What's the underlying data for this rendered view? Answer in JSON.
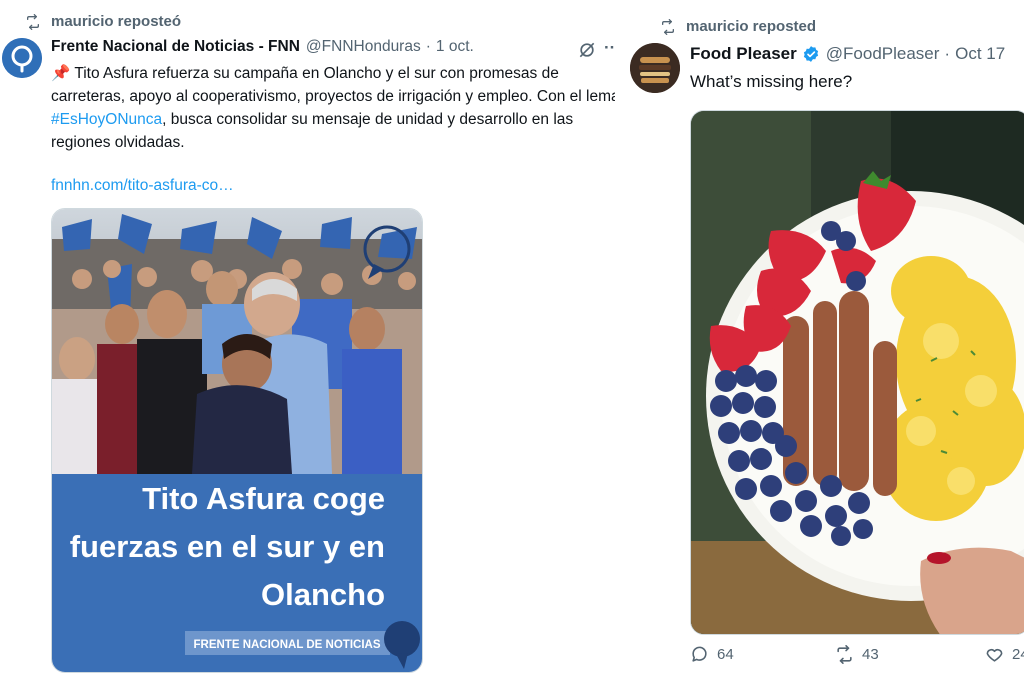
{
  "left_tweet": {
    "repost_text": "mauricio reposteó",
    "author_name": "Frente Nacional de Noticias - FNN",
    "author_handle": "@FNNHonduras",
    "date": "1 oct.",
    "text_pin": "📌",
    "text_part1": " Tito Asfura refuerza su campaña en Olancho y el sur con promesas de carreteras, apoyo al cooperativismo, proyectos de irrigación y empleo. Con el lema ",
    "hashtag": "#EsHoyONunca",
    "text_part2": ", busca consolidar su mensaje de unidad y desarrollo en las regiones olvidadas.",
    "link": "fnnhn.com/tito-asfura-co…",
    "image": {
      "headline_line1": "Tito Asfura coge",
      "headline_line2": "fuerzas en el sur y en",
      "headline_line3": "Olancho",
      "brand_label": "FRENTE NACIONAL DE NOTICIAS",
      "panel_color": "#3a6fb6"
    }
  },
  "right_tweet": {
    "repost_text": "mauricio reposted",
    "author_name": "Food Pleaser",
    "author_handle": "@FoodPleaser",
    "date": "Oct 17",
    "text": "What’s missing here?",
    "replies": "64",
    "reposts": "43",
    "likes": "24"
  },
  "colors": {
    "link_blue": "#1d9bf0",
    "muted_gray": "#536471",
    "verified_blue": "#1d9bf0"
  }
}
